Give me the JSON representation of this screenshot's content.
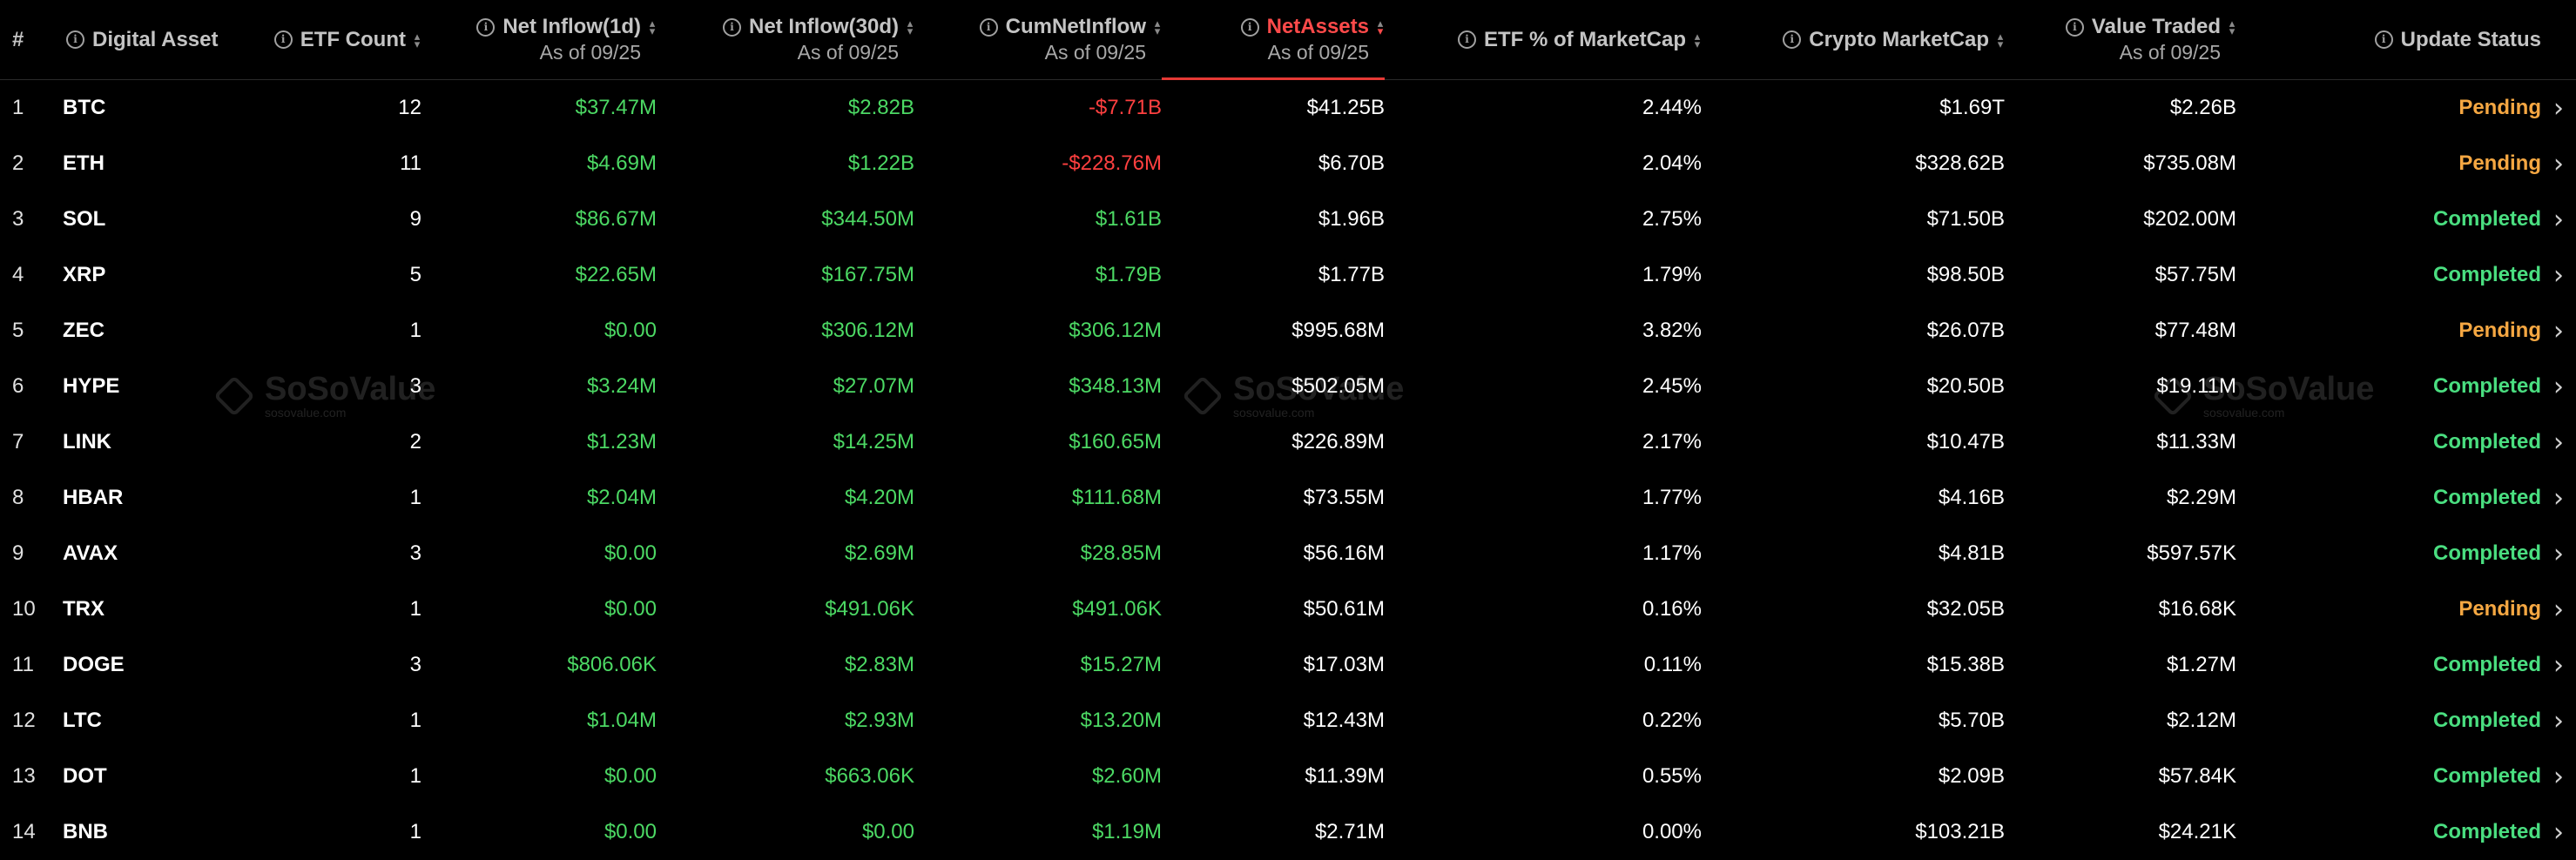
{
  "header": {
    "rank": "#",
    "asset": "Digital Asset",
    "etf_count": "ETF Count",
    "inflow_1d": "Net Inflow(1d)",
    "inflow_30d": "Net Inflow(30d)",
    "cum_inflow": "CumNetInflow",
    "net_assets": "NetAssets",
    "etf_pct": "ETF % of MarketCap",
    "crypto_mcap": "Crypto MarketCap",
    "value_traded": "Value Traded",
    "update_status": "Update Status",
    "as_of": "As of 09/25"
  },
  "icons": {
    "info": "info-icon",
    "sort": "sort-icon",
    "chevron": "chevron-right-icon",
    "watermark_logo": "sosovalue-logo"
  },
  "colors": {
    "positive": "#4cd964",
    "negative": "#ff4040",
    "pending": "#f5a742",
    "completed": "#4ade80",
    "active_sort": "#ff4a4a"
  },
  "sorted_by": "net_assets",
  "watermark": {
    "name": "SoSoValue",
    "url": "sosovalue.com"
  },
  "rows": [
    {
      "rank": "1",
      "asset": "BTC",
      "etf_count": "12",
      "inflow_1d": "$37.47M",
      "inflow_30d": "$2.82B",
      "cum_inflow": "-$7.71B",
      "net_assets": "$41.25B",
      "etf_pct": "2.44%",
      "crypto_mcap": "$1.69T",
      "value_traded": "$2.26B",
      "status": "Pending"
    },
    {
      "rank": "2",
      "asset": "ETH",
      "etf_count": "11",
      "inflow_1d": "$4.69M",
      "inflow_30d": "$1.22B",
      "cum_inflow": "-$228.76M",
      "net_assets": "$6.70B",
      "etf_pct": "2.04%",
      "crypto_mcap": "$328.62B",
      "value_traded": "$735.08M",
      "status": "Pending"
    },
    {
      "rank": "3",
      "asset": "SOL",
      "etf_count": "9",
      "inflow_1d": "$86.67M",
      "inflow_30d": "$344.50M",
      "cum_inflow": "$1.61B",
      "net_assets": "$1.96B",
      "etf_pct": "2.75%",
      "crypto_mcap": "$71.50B",
      "value_traded": "$202.00M",
      "status": "Completed"
    },
    {
      "rank": "4",
      "asset": "XRP",
      "etf_count": "5",
      "inflow_1d": "$22.65M",
      "inflow_30d": "$167.75M",
      "cum_inflow": "$1.79B",
      "net_assets": "$1.77B",
      "etf_pct": "1.79%",
      "crypto_mcap": "$98.50B",
      "value_traded": "$57.75M",
      "status": "Completed"
    },
    {
      "rank": "5",
      "asset": "ZEC",
      "etf_count": "1",
      "inflow_1d": "$0.00",
      "inflow_30d": "$306.12M",
      "cum_inflow": "$306.12M",
      "net_assets": "$995.68M",
      "etf_pct": "3.82%",
      "crypto_mcap": "$26.07B",
      "value_traded": "$77.48M",
      "status": "Pending"
    },
    {
      "rank": "6",
      "asset": "HYPE",
      "etf_count": "3",
      "inflow_1d": "$3.24M",
      "inflow_30d": "$27.07M",
      "cum_inflow": "$348.13M",
      "net_assets": "$502.05M",
      "etf_pct": "2.45%",
      "crypto_mcap": "$20.50B",
      "value_traded": "$19.11M",
      "status": "Completed"
    },
    {
      "rank": "7",
      "asset": "LINK",
      "etf_count": "2",
      "inflow_1d": "$1.23M",
      "inflow_30d": "$14.25M",
      "cum_inflow": "$160.65M",
      "net_assets": "$226.89M",
      "etf_pct": "2.17%",
      "crypto_mcap": "$10.47B",
      "value_traded": "$11.33M",
      "status": "Completed"
    },
    {
      "rank": "8",
      "asset": "HBAR",
      "etf_count": "1",
      "inflow_1d": "$2.04M",
      "inflow_30d": "$4.20M",
      "cum_inflow": "$111.68M",
      "net_assets": "$73.55M",
      "etf_pct": "1.77%",
      "crypto_mcap": "$4.16B",
      "value_traded": "$2.29M",
      "status": "Completed"
    },
    {
      "rank": "9",
      "asset": "AVAX",
      "etf_count": "3",
      "inflow_1d": "$0.00",
      "inflow_30d": "$2.69M",
      "cum_inflow": "$28.85M",
      "net_assets": "$56.16M",
      "etf_pct": "1.17%",
      "crypto_mcap": "$4.81B",
      "value_traded": "$597.57K",
      "status": "Completed"
    },
    {
      "rank": "10",
      "asset": "TRX",
      "etf_count": "1",
      "inflow_1d": "$0.00",
      "inflow_30d": "$491.06K",
      "cum_inflow": "$491.06K",
      "net_assets": "$50.61M",
      "etf_pct": "0.16%",
      "crypto_mcap": "$32.05B",
      "value_traded": "$16.68K",
      "status": "Pending"
    },
    {
      "rank": "11",
      "asset": "DOGE",
      "etf_count": "3",
      "inflow_1d": "$806.06K",
      "inflow_30d": "$2.83M",
      "cum_inflow": "$15.27M",
      "net_assets": "$17.03M",
      "etf_pct": "0.11%",
      "crypto_mcap": "$15.38B",
      "value_traded": "$1.27M",
      "status": "Completed"
    },
    {
      "rank": "12",
      "asset": "LTC",
      "etf_count": "1",
      "inflow_1d": "$1.04M",
      "inflow_30d": "$2.93M",
      "cum_inflow": "$13.20M",
      "net_assets": "$12.43M",
      "etf_pct": "0.22%",
      "crypto_mcap": "$5.70B",
      "value_traded": "$2.12M",
      "status": "Completed"
    },
    {
      "rank": "13",
      "asset": "DOT",
      "etf_count": "1",
      "inflow_1d": "$0.00",
      "inflow_30d": "$663.06K",
      "cum_inflow": "$2.60M",
      "net_assets": "$11.39M",
      "etf_pct": "0.55%",
      "crypto_mcap": "$2.09B",
      "value_traded": "$57.84K",
      "status": "Completed"
    },
    {
      "rank": "14",
      "asset": "BNB",
      "etf_count": "1",
      "inflow_1d": "$0.00",
      "inflow_30d": "$0.00",
      "cum_inflow": "$1.19M",
      "net_assets": "$2.71M",
      "etf_pct": "0.00%",
      "crypto_mcap": "$103.21B",
      "value_traded": "$24.21K",
      "status": "Completed"
    }
  ]
}
